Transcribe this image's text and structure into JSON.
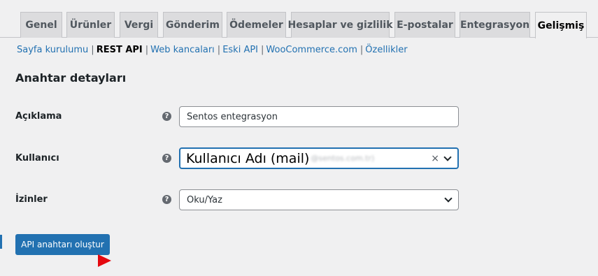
{
  "tabs": [
    "Genel",
    "Ürünler",
    "Vergi",
    "Gönderim",
    "Ödemeler",
    "Hesaplar ve gizlilik",
    "E-postalar",
    "Entegrasyon",
    "Gelişmiş"
  ],
  "active_tab": "Gelişmiş",
  "subnav": {
    "items": [
      "Sayfa kurulumu",
      "REST API",
      "Web kancaları",
      "Eski API",
      "WooCommerce.com",
      "Özellikler"
    ],
    "current": "REST API",
    "separator": "|"
  },
  "section_title": "Anahtar detayları",
  "form": {
    "description": {
      "label": "Açıklama",
      "value": "Sentos entegrasyon"
    },
    "user": {
      "label": "Kullanıcı",
      "value": "Kullanıcı Adı (mail)",
      "blurred_suffix": "@sentos.com.tr)",
      "clear_symbol": "×"
    },
    "permissions": {
      "label": "İzinler",
      "value": "Oku/Yaz"
    },
    "help_symbol": "?"
  },
  "submit_label": "API anahtarı oluştur",
  "colors": {
    "accent": "#2271b1",
    "arrow": "#e5080f",
    "background": "#f0f0f1"
  }
}
